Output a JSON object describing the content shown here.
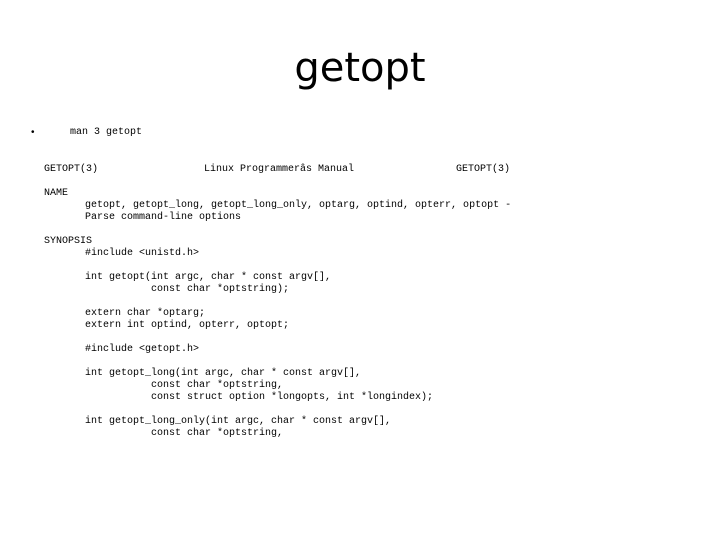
{
  "slide": {
    "title": "getopt",
    "bullet_symbol": "•",
    "bullet_text": "man 3 getopt"
  },
  "manpage": {
    "header_left": "GETOPT(3)",
    "header_center": "Linux Programmerâs Manual",
    "header_right": "GETOPT(3)",
    "name_section": {
      "heading": "NAME",
      "lines": [
        "getopt, getopt_long, getopt_long_only, optarg, optind, opterr, optopt -",
        "Parse command-line options"
      ]
    },
    "synopsis_section": {
      "heading": "SYNOPSIS",
      "include_unistd": "#include <unistd.h>",
      "getopt_decl": [
        "int getopt(int argc, char * const argv[],",
        "           const char *optstring);"
      ],
      "externs": [
        "extern char *optarg;",
        "extern int optind, opterr, optopt;"
      ],
      "include_getopt": "#include <getopt.h>",
      "getopt_long_decl": [
        "int getopt_long(int argc, char * const argv[],",
        "           const char *optstring,",
        "           const struct option *longopts, int *longindex);"
      ],
      "getopt_long_only_decl": [
        "int getopt_long_only(int argc, char * const argv[],",
        "           const char *optstring,"
      ]
    }
  }
}
